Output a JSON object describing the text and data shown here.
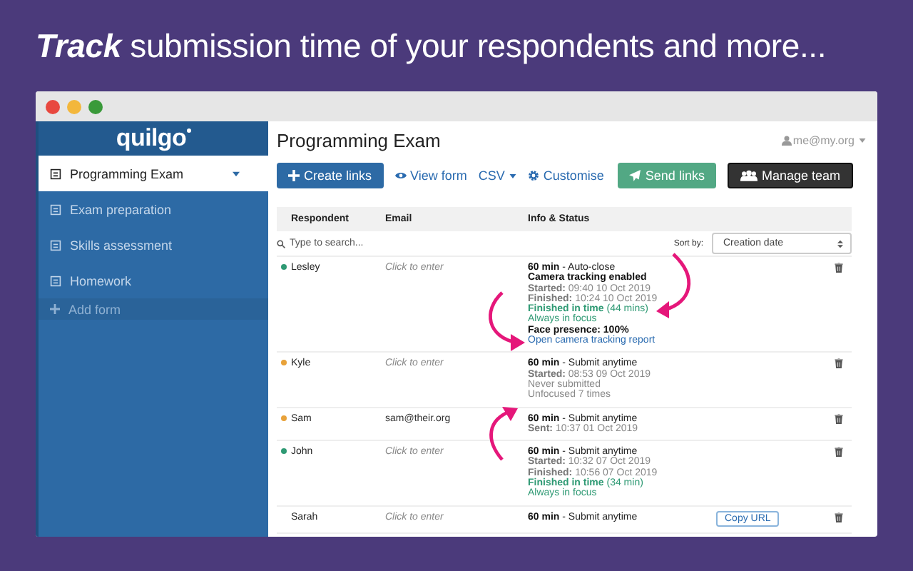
{
  "headline": "**Track** submission time of your respondents and more...",
  "sidebar": {
    "logo": "quilgo",
    "items": [
      {
        "label": "Programming Exam",
        "selected": true
      },
      {
        "label": "Exam preparation",
        "selected": false
      },
      {
        "label": "Skills assessment",
        "selected": false
      },
      {
        "label": "Homework",
        "selected": false
      }
    ],
    "add_form": "Add form"
  },
  "header": {
    "title": "Programming Exam",
    "user": "me@my.org"
  },
  "toolbar": [
    {
      "kind": "primary",
      "label": "Create links"
    },
    {
      "kind": "view",
      "label": "View form"
    },
    {
      "kind": "menu",
      "label": "CSV"
    },
    {
      "kind": "settings",
      "label": "Customise"
    },
    {
      "kind": "send",
      "label": "Send links"
    },
    {
      "kind": "team",
      "label": "Manage team"
    }
  ],
  "table": {
    "columns": [
      "Respondent",
      "Email",
      "Info & Status"
    ],
    "search": {
      "placeholder": "Type to search..."
    },
    "sort_label": "Sort by:",
    "sort_value": "Creation date",
    "rows": [
      {
        "name": "Lesley",
        "color": "#2f9a74",
        "email": {
          "placeholder": "Click to enter"
        },
        "lines": [
          {
            "kind": "head",
            "text": "**60 min** - Auto-close"
          },
          {
            "kind": "strong",
            "text": "Camera tracking enabled"
          },
          {
            "kind": "label",
            "text": "**Started:** 09:40 10 Oct 2019"
          },
          {
            "kind": "label",
            "text": "**Finished:** 10:24 10 Oct 2019"
          },
          {
            "kind": "success",
            "text": "**Finished in time** (44 mins)"
          },
          {
            "kind": "success",
            "text": "Always in focus"
          },
          {
            "kind": "strong",
            "text": "Face presence: 100%"
          },
          {
            "kind": "link",
            "text": "Open camera tracking report"
          }
        ]
      },
      {
        "name": "Kyle",
        "color": "#e8a23a",
        "email": {
          "placeholder": "Click to enter"
        },
        "lines": [
          {
            "kind": "head",
            "text": "**60 min** - Submit anytime"
          },
          {
            "kind": "label",
            "text": "**Started:** 08:53 09 Oct 2019"
          },
          {
            "kind": "muted",
            "text": "Never submitted"
          },
          {
            "kind": "muted",
            "text": "Unfocused 7 times"
          }
        ]
      },
      {
        "name": "Sam",
        "color": "#e8a23a",
        "email": {
          "value": "sam@their.org"
        },
        "lines": [
          {
            "kind": "head",
            "text": "**60 min** - Submit anytime"
          },
          {
            "kind": "label",
            "text": "**Sent:** 10:37 01 Oct 2019"
          }
        ]
      },
      {
        "name": "John",
        "color": "#2f9a74",
        "email": {
          "placeholder": "Click to enter"
        },
        "lines": [
          {
            "kind": "head",
            "text": "**60 min** - Submit anytime"
          },
          {
            "kind": "label",
            "text": "**Started:** 10:32 07 Oct 2019"
          },
          {
            "kind": "label",
            "text": "**Finished:** 10:56 07 Oct 2019"
          },
          {
            "kind": "success",
            "text": "**Finished in time** (34 min)"
          },
          {
            "kind": "success",
            "text": "Always in focus"
          }
        ]
      },
      {
        "name": "Sarah",
        "email": {
          "placeholder": "Click to enter"
        },
        "action": "Copy URL",
        "lines": [
          {
            "kind": "head",
            "text": "**60 min** - Submit anytime"
          }
        ]
      }
    ]
  }
}
